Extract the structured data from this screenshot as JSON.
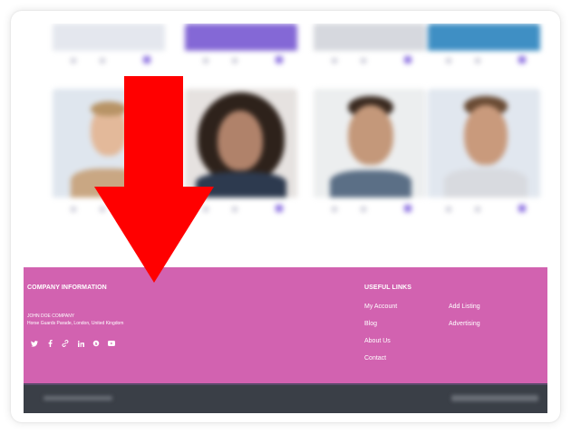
{
  "footer": {
    "company_heading": "COMPANY INFORMATION",
    "company_name": "JOHN DOE COMPANY",
    "company_address": "Horse Guards Parade, London, United Kingdom",
    "links_heading": "USEFUL LINKS",
    "links_col1": [
      "My Account",
      "Blog",
      "About Us",
      "Contact"
    ],
    "links_col2": [
      "Add Listing",
      "Advertising"
    ],
    "social_icons": [
      "twitter-icon",
      "facebook-icon",
      "link-icon",
      "linkedin-icon",
      "skype-icon",
      "youtube-icon"
    ],
    "background_color": "#d262b0"
  },
  "bottom_bar": {
    "color": "#3a3f47"
  },
  "overlay": {
    "arrow_color": "#ff0000",
    "arrow_direction": "down"
  }
}
